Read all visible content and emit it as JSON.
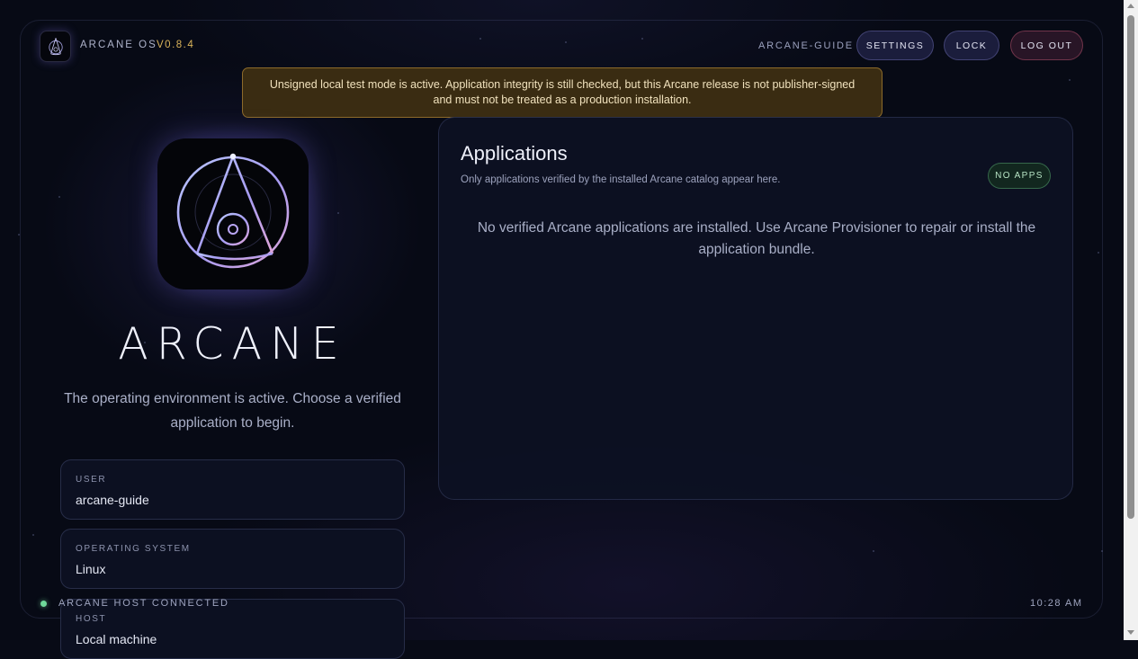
{
  "header": {
    "brand": "ARCANE OS",
    "version": "V0.8.4",
    "username": "ARCANE-GUIDE",
    "buttons": {
      "settings": "SETTINGS",
      "lock": "LOCK",
      "logout": "LOG OUT"
    }
  },
  "warning": {
    "text": "Unsigned local test mode is active. Application integrity is still checked, but this Arcane release is not publisher-signed and must not be treated as a production installation."
  },
  "hero": {
    "logo_icon": "arcane-compass-logo",
    "title": "ARCANE",
    "subtitle": "The operating environment is active. Choose a verified application to begin."
  },
  "info_cards": [
    {
      "label": "USER",
      "value": "arcane-guide"
    },
    {
      "label": "OPERATING SYSTEM",
      "value": "Linux"
    },
    {
      "label": "HOST",
      "value": "Local machine"
    }
  ],
  "applications": {
    "title": "Applications",
    "subtitle": "Only applications verified by the installed Arcane catalog appear here.",
    "badge": "NO APPS",
    "empty_message": "No verified Arcane applications are installed. Use Arcane Provisioner to repair or install the application bundle."
  },
  "footer": {
    "status": "ARCANE HOST CONNECTED",
    "time": "10:28 AM"
  },
  "colors": {
    "accent_gold": "#d9b35a",
    "status_green": "#6fd99a",
    "warning_bg": "#3a2c12"
  }
}
